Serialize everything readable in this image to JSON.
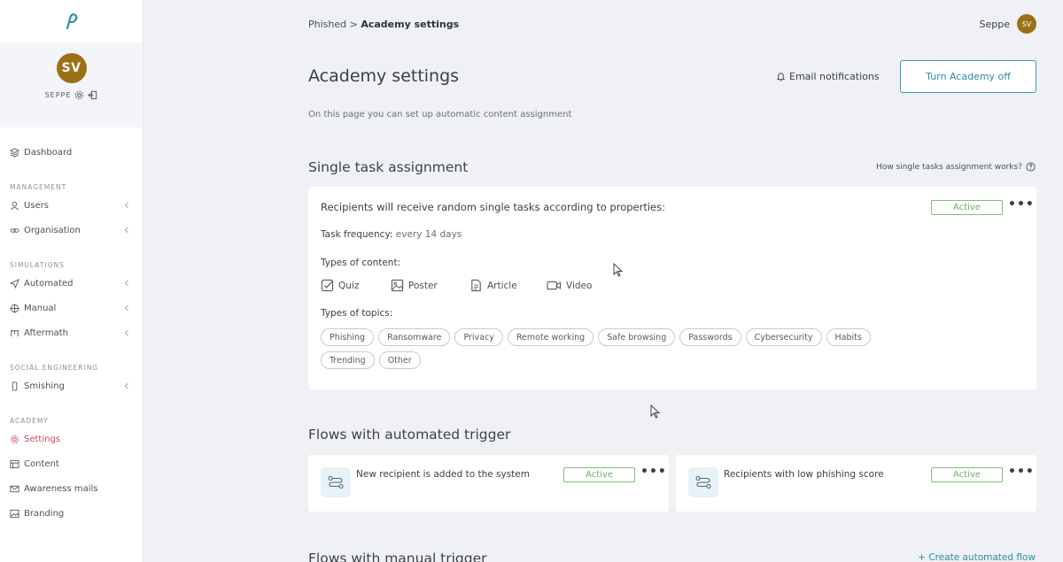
{
  "user": {
    "initials": "SV",
    "name": "SEPPE",
    "display_name": "Seppe"
  },
  "sidebar": {
    "dashboard": "Dashboard",
    "management_header": "MANAGEMENT",
    "users": "Users",
    "organisation": "Organisation",
    "simulations_header": "SIMULATIONS",
    "automated": "Automated",
    "manual": "Manual",
    "aftermath": "Aftermath",
    "social_header": "SOCIAL ENGINEERING",
    "smishing": "Smishing",
    "academy_header": "ACADEMY",
    "settings": "Settings",
    "content": "Content",
    "awareness": "Awareness mails",
    "branding": "Branding"
  },
  "breadcrumb": {
    "root": "Phished",
    "separator": " > ",
    "current": "Academy settings"
  },
  "page": {
    "title": "Academy settings",
    "email_notifications": "Email notifications",
    "turn_off": "Turn Academy off",
    "subtitle": "On this page you can set up automatic content assignment"
  },
  "single_task": {
    "title": "Single task assignment",
    "help": "How single tasks assignment works?",
    "heading": "Recipients will receive random single tasks according to properties:",
    "status": "Active",
    "freq_label": "Task frequency:",
    "freq_value": " every 14 days",
    "content_label": "Types of content:",
    "content_types": [
      "Quiz",
      "Poster",
      "Article",
      "Video"
    ],
    "topics_label": "Types of topics:",
    "topics_row1": [
      "Phishing",
      "Ransomware",
      "Privacy",
      "Remote working",
      "Safe browsing",
      "Passwords",
      "Cybersecurity",
      "Habits"
    ],
    "topics_row2": [
      "Trending",
      "Other"
    ]
  },
  "flows_auto": {
    "title": "Flows with automated trigger",
    "items": [
      {
        "title": "New recipient is added to the system",
        "status": "Active"
      },
      {
        "title": "Recipients with low phishing score",
        "status": "Active"
      }
    ]
  },
  "flows_manual": {
    "title": "Flows with manual trigger",
    "create": "+ Create automated flow"
  },
  "colors": {
    "accent": "#2f8ba6",
    "active_green": "#6caf66",
    "avatar": "#9c7016",
    "nav_active": "#c6485a"
  }
}
